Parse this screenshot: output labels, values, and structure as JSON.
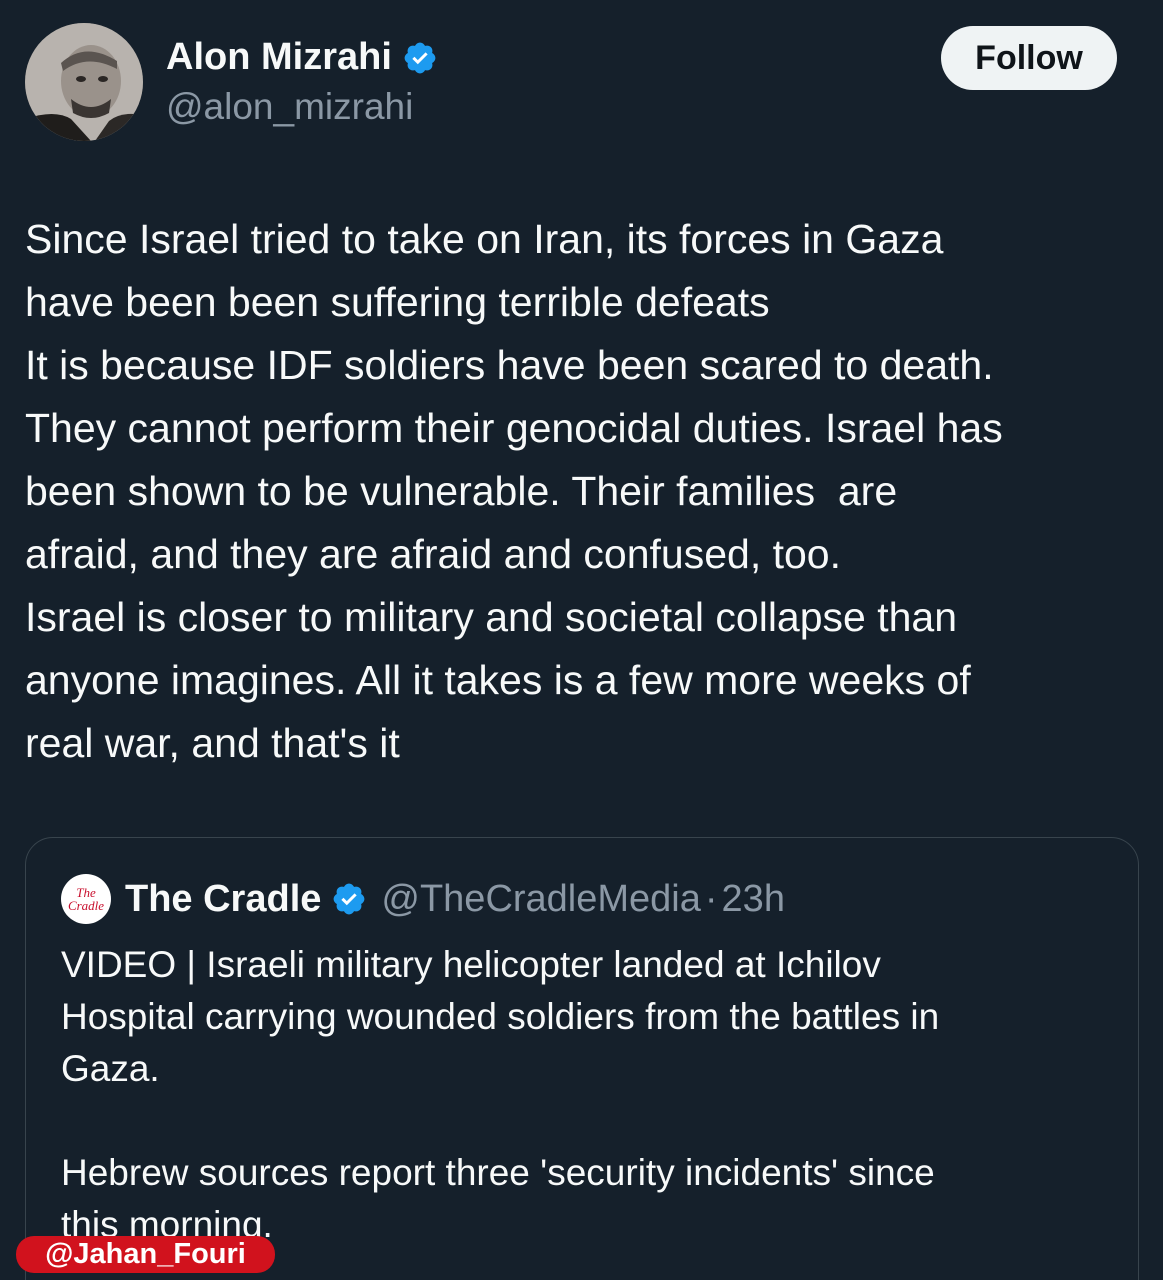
{
  "author": {
    "display_name": "Alon Mizrahi",
    "handle": "@alon_mizrahi",
    "verified_icon": "verified-badge-icon",
    "badge_color": "#1d9bf0"
  },
  "follow_label": "Follow",
  "tweet": {
    "lines": [
      "Since Israel tried to take on Iran, its forces in Gaza",
      "have been been suffering terrible defeats",
      "It is because IDF soldiers have been scared to death.",
      "They cannot perform their genocidal duties. Israel has",
      "been shown to be vulnerable. Their families  are",
      "afraid, and they are afraid and confused, too.",
      "Israel is closer to military and societal collapse than",
      "anyone imagines. All it takes is a few more weeks of",
      "real war, and that's it"
    ]
  },
  "quote": {
    "logo_text_top": "The",
    "logo_text_bottom": "Cradle",
    "name": "The Cradle",
    "handle": "@TheCradleMedia",
    "separator": "·",
    "time": "23h",
    "lines": [
      "VIDEO | Israeli military helicopter landed at Ichilov",
      "Hospital carrying wounded soldiers from the battles in",
      "Gaza.",
      "",
      "Hebrew sources report three 'security incidents' since",
      "this morning."
    ]
  },
  "watermark": "@Jahan_Fouri",
  "colors": {
    "background": "#15202b",
    "text": "#f7f9f9",
    "secondary_text": "#8b98a5",
    "border": "#38444d",
    "watermark": "#d1121d"
  }
}
